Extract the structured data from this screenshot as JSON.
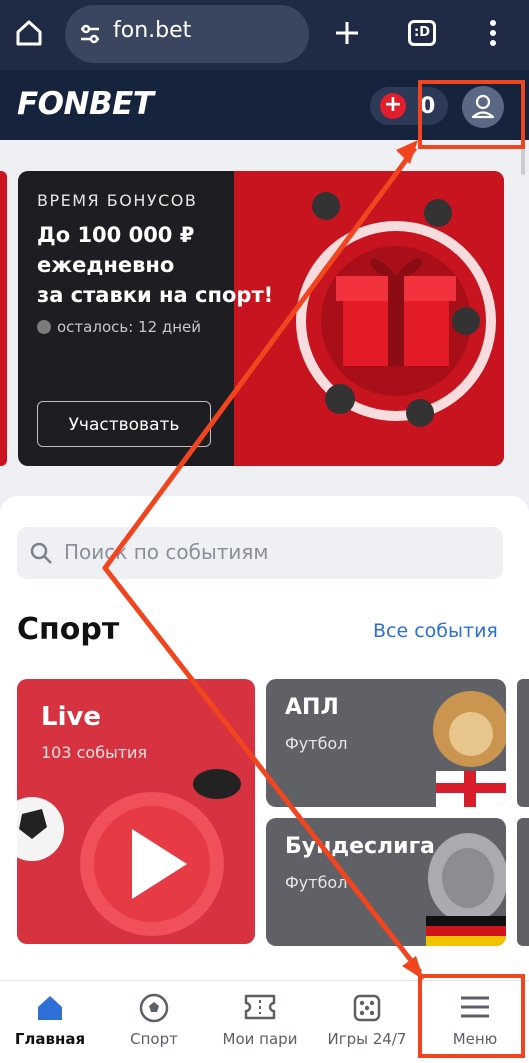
{
  "browser": {
    "url": "fon.bet",
    "tab_switch_label": ":D"
  },
  "header": {
    "logo": "FONBET",
    "balance_plus": "+",
    "balance_text": "0"
  },
  "banner": {
    "kicker": "ВРЕМЯ БОНУСОВ",
    "title_line1": "До 100 000 ₽",
    "title_line2": "ежедневно",
    "title_line3": "за ставки на спорт!",
    "timer": "осталось: 12 дней",
    "button": "Участвовать"
  },
  "search": {
    "placeholder": "Поиск по событиям"
  },
  "sport": {
    "title": "Спорт",
    "all_events": "Все события",
    "live": {
      "title": "Live",
      "subtitle": "103 события"
    },
    "leagues": [
      {
        "title": "АПЛ",
        "subtitle": "Футбол"
      },
      {
        "title": "Бундеслига",
        "subtitle": "Футбол"
      }
    ]
  },
  "bottom_nav": {
    "items": [
      {
        "label": "Главная",
        "icon": "home-icon",
        "active": true
      },
      {
        "label": "Спорт",
        "icon": "ball-icon",
        "active": false
      },
      {
        "label": "Мои пари",
        "icon": "ticket-icon",
        "active": false
      },
      {
        "label": "Игры 24/7",
        "icon": "dice-icon",
        "active": false
      },
      {
        "label": "Меню",
        "icon": "menu-icon",
        "active": false
      }
    ]
  },
  "colors": {
    "brand_dark": "#16233d",
    "accent_red": "#e21e2c",
    "link_blue": "#2b6fd6",
    "annotation": "#f0451f"
  }
}
